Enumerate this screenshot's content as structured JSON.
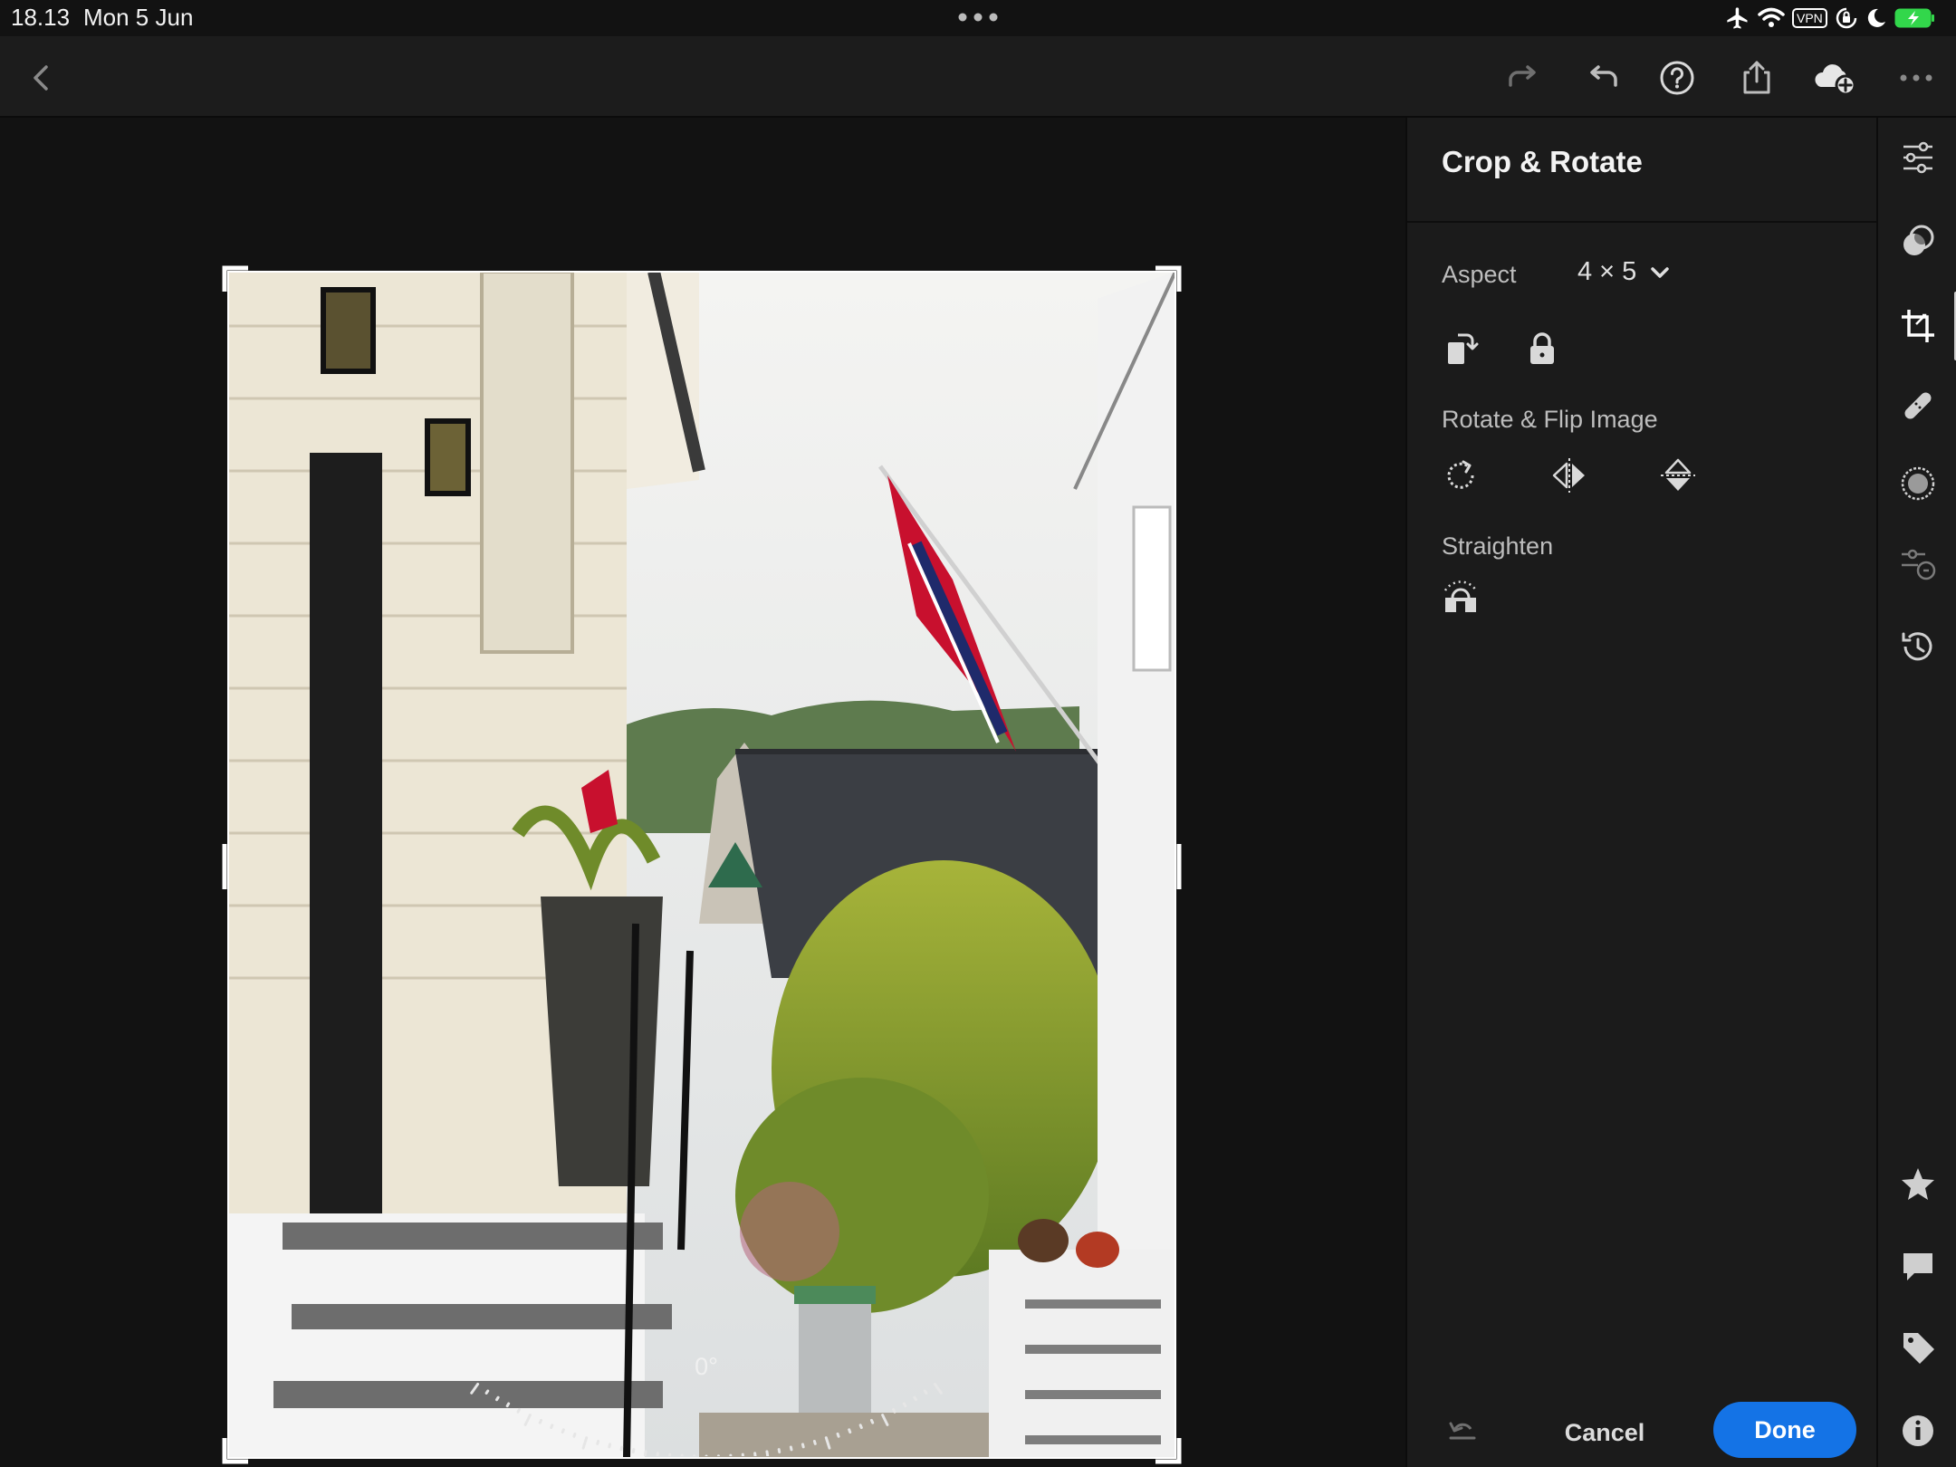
{
  "status_bar": {
    "time": "18.13",
    "date": "Mon 5 Jun",
    "vpn_label": "VPN",
    "icons": [
      "airplane-icon",
      "wifi-icon",
      "vpn-icon",
      "orientation-lock-icon",
      "moon-icon",
      "battery-charging-icon"
    ]
  },
  "toolbar": {
    "icons": [
      "back-icon",
      "redo-icon",
      "undo-icon",
      "help-icon",
      "share-icon",
      "cloud-add-icon",
      "more-icon"
    ]
  },
  "photo": {
    "angle": "0°"
  },
  "panel": {
    "title": "Crop & Rotate",
    "aspect_label": "Aspect",
    "aspect_value": "4 × 5",
    "rotate_flip_label": "Rotate & Flip Image",
    "straighten_label": "Straighten",
    "cancel_label": "Cancel",
    "done_label": "Done"
  },
  "rail": {
    "items": [
      "edit-sliders-icon",
      "presets-icon",
      "crop-icon",
      "healing-icon",
      "masking-icon",
      "versions-icon",
      "history-icon",
      "star-icon",
      "comment-icon",
      "tag-icon",
      "info-icon"
    ],
    "active": "crop-icon"
  },
  "colors": {
    "accent": "#1473e6",
    "background": "#121212",
    "panel": "#1b1b1b"
  }
}
